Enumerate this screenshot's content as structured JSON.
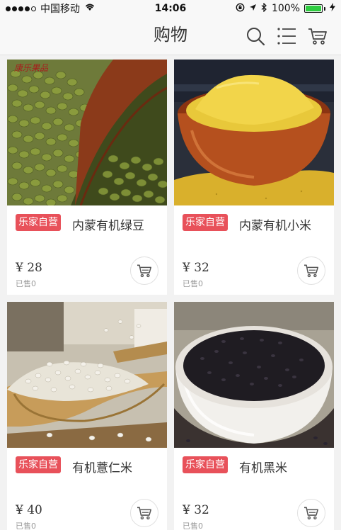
{
  "status_bar": {
    "carrier": "中国移动",
    "time": "14:06",
    "battery": "100%"
  },
  "header": {
    "title": "购物",
    "icons": [
      "search-icon",
      "menu-list-icon",
      "cart-icon"
    ]
  },
  "products": [
    {
      "badge": "乐家自营",
      "name": "内蒙有机绿豆",
      "price": "¥ 28",
      "sold": "已售0",
      "image": "mung-beans",
      "watermark": "康乐果品"
    },
    {
      "badge": "乐家自营",
      "name": "内蒙有机小米",
      "price": "¥ 32",
      "sold": "已售0",
      "image": "millet"
    },
    {
      "badge": "乐家自营",
      "name": "有机薏仁米",
      "price": "¥ 40",
      "sold": "已售0",
      "image": "barley"
    },
    {
      "badge": "乐家自营",
      "name": "有机黑米",
      "price": "¥ 32",
      "sold": "已售0",
      "image": "black-rice"
    }
  ],
  "colors": {
    "badge_bg": "#e8515a",
    "background": "#f2f2f2",
    "battery": "#2ecc40"
  }
}
